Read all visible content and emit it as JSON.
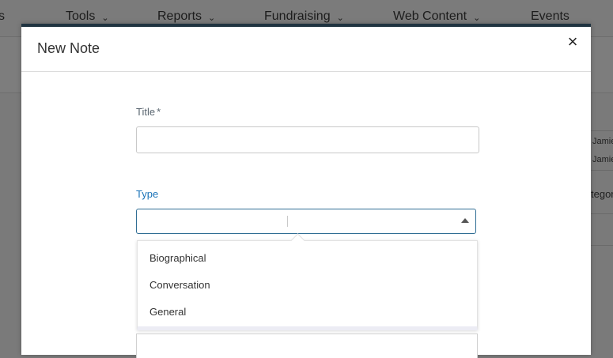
{
  "nav": {
    "items": [
      {
        "label": "Tools"
      },
      {
        "label": "Reports"
      },
      {
        "label": "Fundraising"
      },
      {
        "label": "Web Content"
      },
      {
        "label": "Events"
      }
    ],
    "left_partial": "s"
  },
  "background": {
    "row1": "Jamie",
    "row2": "Jamie",
    "row3": "tegor"
  },
  "modal": {
    "title": "New Note",
    "close_label": "×",
    "title_field": {
      "label": "Title",
      "required_mark": "*",
      "value": ""
    },
    "type_field": {
      "label": "Type",
      "value": ""
    },
    "type_options": [
      "Biographical",
      "Conversation",
      "General"
    ]
  }
}
